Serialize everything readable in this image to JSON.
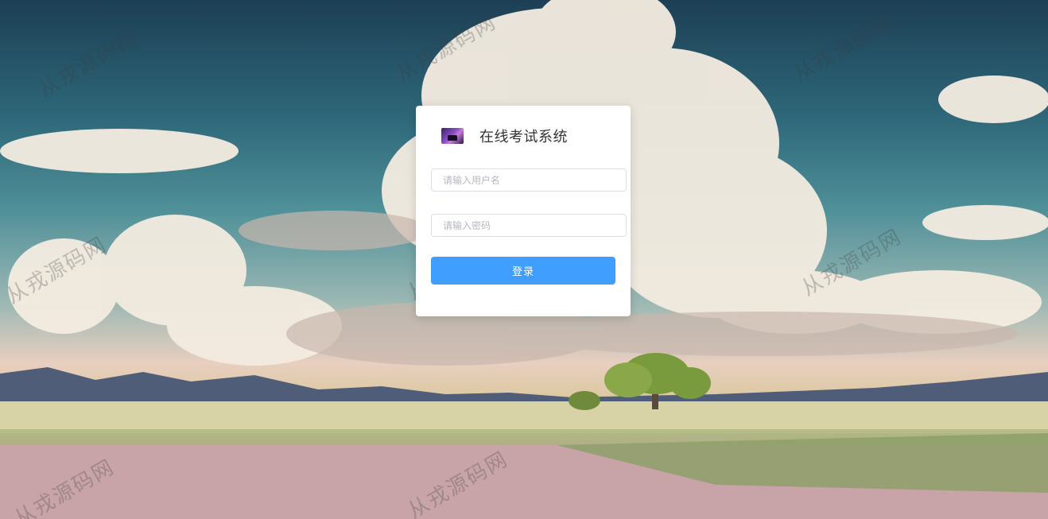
{
  "app": {
    "title": "在线考试系统"
  },
  "login": {
    "username_placeholder": "请输入用户名",
    "username_value": "",
    "password_placeholder": "请输入密码",
    "password_value": "",
    "submit_label": "登录"
  },
  "background": {
    "watermark_text": "从戎源码网"
  },
  "colors": {
    "primary": "#409eff",
    "card": "#ffffff"
  },
  "icons": {
    "logo": "app-logo-icon"
  }
}
